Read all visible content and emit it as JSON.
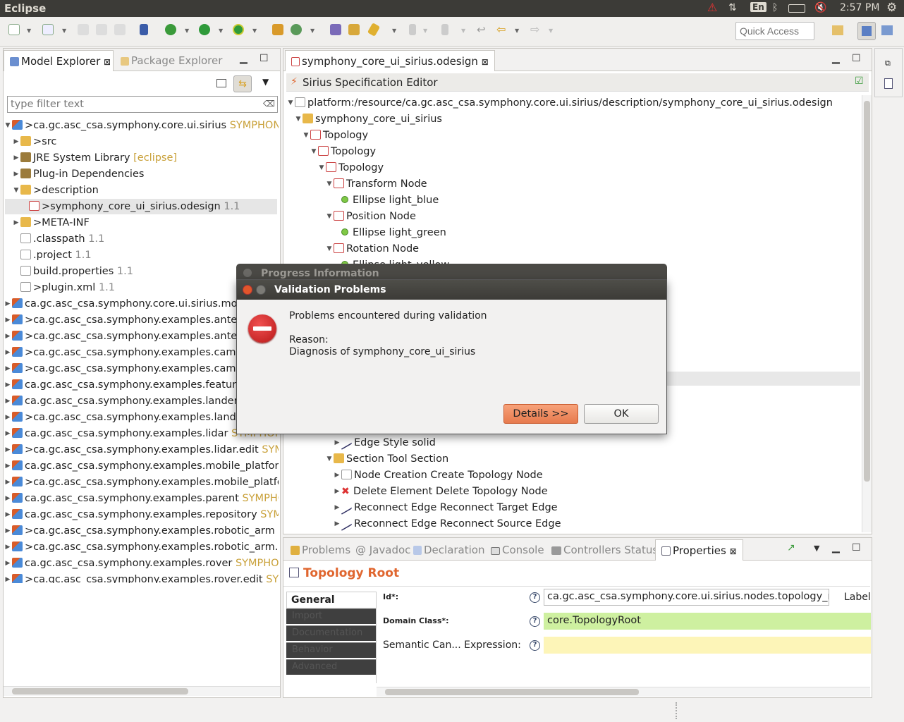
{
  "topbar": {
    "title": "Eclipse",
    "lang": "En",
    "time": "2:57 PM"
  },
  "toolbar": {
    "quick_access_placeholder": "Quick Access"
  },
  "explorer": {
    "tab_active": "Model Explorer",
    "tab_inactive": "Package Explorer",
    "filter_placeholder": "type filter text",
    "items": [
      {
        "label": ">ca.gc.asc_csa.symphony.core.ui.sirius",
        "suffix": "SYMPHONY_C",
        "icon": "project-icon",
        "arrow": "▼",
        "indent": 0
      },
      {
        "label": ">src",
        "suffix": "",
        "icon": "source-folder-icon",
        "arrow": "▶",
        "indent": 1
      },
      {
        "label": "JRE System Library",
        "suffix": "[eclipse]",
        "icon": "library-icon",
        "arrow": "▶",
        "indent": 1
      },
      {
        "label": "Plug-in Dependencies",
        "suffix": "",
        "icon": "library-icon",
        "arrow": "▶",
        "indent": 1
      },
      {
        "label": ">description",
        "suffix": "",
        "icon": "folder-icon",
        "arrow": "▼",
        "indent": 1
      },
      {
        "label": ">symphony_core_ui_sirius.odesign",
        "suffix": "1.1",
        "icon": "odesign-file-icon",
        "arrow": "",
        "indent": 2,
        "selected": true
      },
      {
        "label": ">META-INF",
        "suffix": "",
        "icon": "folder-icon",
        "arrow": "▶",
        "indent": 1
      },
      {
        "label": ".classpath",
        "suffix": "1.1",
        "icon": "file-icon",
        "arrow": "",
        "indent": 1
      },
      {
        "label": ".project",
        "suffix": "1.1",
        "icon": "file-icon",
        "arrow": "",
        "indent": 1
      },
      {
        "label": "build.properties",
        "suffix": "1.1",
        "icon": "file-icon",
        "arrow": "",
        "indent": 1
      },
      {
        "label": ">plugin.xml",
        "suffix": "1.1",
        "icon": "file-icon",
        "arrow": "",
        "indent": 1
      },
      {
        "label": "ca.gc.asc_csa.symphony.core.ui.sirius.model",
        "suffix": "",
        "icon": "project-icon",
        "arrow": "▶",
        "indent": 0
      },
      {
        "label": ">ca.gc.asc_csa.symphony.examples.antenna",
        "suffix": "",
        "icon": "project-icon",
        "arrow": "▶",
        "indent": 0
      },
      {
        "label": ">ca.gc.asc_csa.symphony.examples.antenna",
        "suffix": "",
        "icon": "project-icon",
        "arrow": "▶",
        "indent": 0
      },
      {
        "label": ">ca.gc.asc_csa.symphony.examples.camera",
        "suffix": "",
        "icon": "project-icon",
        "arrow": "▶",
        "indent": 0
      },
      {
        "label": ">ca.gc.asc_csa.symphony.examples.camera.",
        "suffix": "",
        "icon": "project-icon",
        "arrow": "▶",
        "indent": 0
      },
      {
        "label": "ca.gc.asc_csa.symphony.examples.feature",
        "suffix": "S",
        "icon": "project-icon",
        "arrow": "▶",
        "indent": 0
      },
      {
        "label": "ca.gc.asc_csa.symphony.examples.lander",
        "suffix": "SY",
        "icon": "project-icon",
        "arrow": "▶",
        "indent": 0
      },
      {
        "label": ">ca.gc.asc_csa.symphony.examples.lander.e",
        "suffix": "",
        "icon": "project-icon",
        "arrow": "▶",
        "indent": 0
      },
      {
        "label": "ca.gc.asc_csa.symphony.examples.lidar",
        "suffix": "SYMPHONY_",
        "icon": "project-icon",
        "arrow": "▶",
        "indent": 0
      },
      {
        "label": ">ca.gc.asc_csa.symphony.examples.lidar.edit",
        "suffix": "SYMPH",
        "icon": "project-icon",
        "arrow": "▶",
        "indent": 0
      },
      {
        "label": "ca.gc.asc_csa.symphony.examples.mobile_platform",
        "suffix": "",
        "icon": "project-icon",
        "arrow": "▶",
        "indent": 0
      },
      {
        "label": ">ca.gc.asc_csa.symphony.examples.mobile_platform",
        "suffix": "",
        "icon": "project-icon",
        "arrow": "▶",
        "indent": 0
      },
      {
        "label": "ca.gc.asc_csa.symphony.examples.parent",
        "suffix": "SYMPHON",
        "icon": "project-icon",
        "arrow": "▶",
        "indent": 0
      },
      {
        "label": "ca.gc.asc_csa.symphony.examples.repository",
        "suffix": "SYMPH",
        "icon": "project-icon",
        "arrow": "▶",
        "indent": 0
      },
      {
        "label": ">ca.gc.asc_csa.symphony.examples.robotic_arm",
        "suffix": "SYN",
        "icon": "project-icon",
        "arrow": "▶",
        "indent": 0
      },
      {
        "label": ">ca.gc.asc_csa.symphony.examples.robotic_arm.edit",
        "suffix": "",
        "icon": "project-icon",
        "arrow": "▶",
        "indent": 0
      },
      {
        "label": "ca.gc.asc_csa.symphony.examples.rover",
        "suffix": "SYMPHONY",
        "icon": "project-icon",
        "arrow": "▶",
        "indent": 0
      },
      {
        "label": ">ca.gc.asc_csa.symphony.examples.rover.edit",
        "suffix": "SYMPI",
        "icon": "project-icon",
        "arrow": "▶",
        "indent": 0
      }
    ]
  },
  "editor": {
    "tab": "symphony_core_ui_sirius.odesign",
    "header": "Sirius Specification Editor",
    "items": [
      {
        "label": "platform:/resource/ca.gc.asc_csa.symphony.core.ui.sirius/description/symphony_core_ui_sirius.odesign",
        "icon": "resource-icon",
        "arrow": "▼",
        "indent": 0
      },
      {
        "label": "symphony_core_ui_sirius",
        "icon": "viewpoint-group-icon",
        "arrow": "▼",
        "indent": 1
      },
      {
        "label": "Topology",
        "icon": "viewpoint-icon",
        "arrow": "▼",
        "indent": 2
      },
      {
        "label": "Topology",
        "icon": "diagram-description-icon",
        "arrow": "▼",
        "indent": 3
      },
      {
        "label": "Topology",
        "icon": "layer-icon",
        "arrow": "▼",
        "indent": 4
      },
      {
        "label": "Transform Node",
        "icon": "node-icon",
        "arrow": "▼",
        "indent": 5
      },
      {
        "label": "Ellipse light_blue",
        "icon": "ellipse-icon",
        "arrow": "",
        "indent": 6
      },
      {
        "label": "Position Node",
        "icon": "node-icon",
        "arrow": "▼",
        "indent": 5
      },
      {
        "label": "Ellipse light_green",
        "icon": "ellipse-icon",
        "arrow": "",
        "indent": 6
      },
      {
        "label": "Rotation Node",
        "icon": "node-icon",
        "arrow": "▼",
        "indent": 5
      },
      {
        "label": "Ellipse light_yellow",
        "icon": "ellipse-icon",
        "arrow": "",
        "indent": 6
      }
    ],
    "items_lower": [
      {
        "label": "Edge Style solid",
        "icon": "edge-style-icon",
        "arrow": "▶",
        "indent": 6
      },
      {
        "label": "Section Tool Section",
        "icon": "tool-section-icon",
        "arrow": "▼",
        "indent": 5
      },
      {
        "label": "Node Creation Create Topology Node",
        "icon": "node-creation-icon",
        "arrow": "▶",
        "indent": 6
      },
      {
        "label": "Delete Element Delete Topology Node",
        "icon": "delete-icon",
        "arrow": "▶",
        "indent": 6
      },
      {
        "label": "Reconnect Edge Reconnect Target Edge",
        "icon": "reconnect-edge-icon",
        "arrow": "▶",
        "indent": 6
      },
      {
        "label": "Reconnect Edge Reconnect Source Edge",
        "icon": "reconnect-edge-icon",
        "arrow": "▶",
        "indent": 6
      }
    ]
  },
  "bottom": {
    "tabs": [
      "Problems",
      "Javadoc",
      "Declaration",
      "Console",
      "Controllers Status"
    ],
    "active_tab": "Properties",
    "title": "Topology Root",
    "side_tabs": [
      "General",
      "Import",
      "Documentation",
      "Behavior",
      "Advanced"
    ],
    "fields": {
      "id_label": "Id*:",
      "id_value": "ca.gc.asc_csa.symphony.core.ui.sirius.nodes.topology_root",
      "label_label": "Label",
      "domain_label": "Domain Class*:",
      "domain_value": "core.TopologyRoot",
      "semantic_label": "Semantic Can... Expression:",
      "semantic_value": ""
    }
  },
  "progress_dialog": {
    "title": "Progress Information"
  },
  "dialog": {
    "title": "Validation Problems",
    "message": "Problems encountered during validation",
    "reason_label": "Reason:",
    "reason_text": "Diagnosis of symphony_core_ui_sirius",
    "details_button": "Details >>",
    "ok_button": "OK"
  },
  "colors": {
    "accent": "#e77a4d",
    "domain_field": "#cef0a0",
    "semantic_field": "#fdf5b8",
    "title": "#e0662f"
  }
}
